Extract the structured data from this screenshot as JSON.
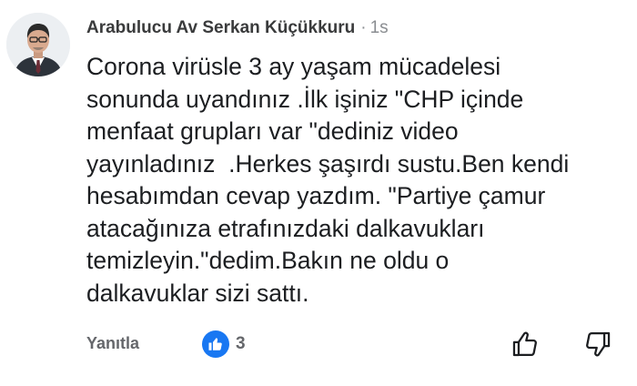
{
  "comment": {
    "author": "Arabulucu Av Serkan Küçükkuru",
    "separator": "·",
    "time": "1s",
    "lines": [
      "Corona virüsle 3 ay yaşam mücadelesi",
      "sonunda uyandınız .İlk işiniz \"CHP içinde",
      "menfaat grupları var \"dediniz video",
      "yayınladınız  .Herkes şaşırdı sustu.Ben kendi",
      "hesabımdan cevap yazdım. \"Partiye çamur",
      "atacağınıza etrafınızdaki dalkavukları",
      "temizleyin.\"dedim.Bakın ne oldu o",
      "dalkavuklar sizi sattı."
    ]
  },
  "actions": {
    "reply_label": "Yanıtla",
    "like_count": "3",
    "like_icon": "thumb-up-icon",
    "reaction_color": "#1877f2"
  }
}
